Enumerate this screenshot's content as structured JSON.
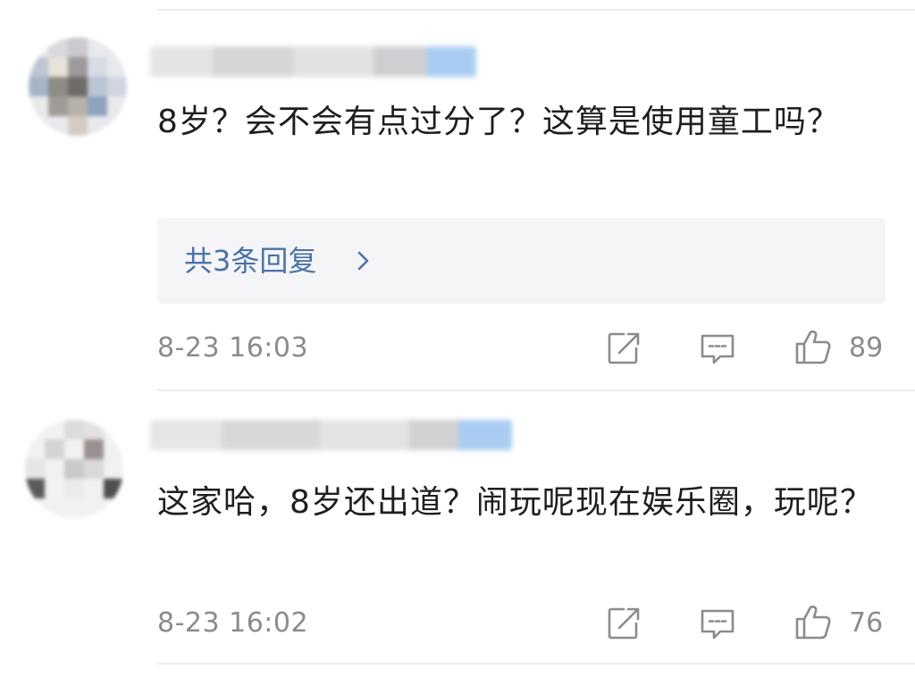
{
  "comments": [
    {
      "text": "8岁？会不会有点过分了？这算是使用童工吗？",
      "replies_label": "共3条回复",
      "time": "8-23 16:03",
      "likes": "89",
      "icons": [
        "share-icon",
        "comment-icon",
        "like-icon"
      ]
    },
    {
      "text": "这家哈，8岁还出道？闹玩呢现在娱乐圈，玩呢？",
      "time": "8-23 16:02",
      "likes": "76",
      "icons": [
        "share-icon",
        "comment-icon",
        "like-icon"
      ]
    }
  ],
  "colors": {
    "text": "#1e1e1e",
    "meta": "#8b8b8b",
    "link": "#4a72a8",
    "reply_bg": "#f5f5f7",
    "divider": "#ececec"
  }
}
